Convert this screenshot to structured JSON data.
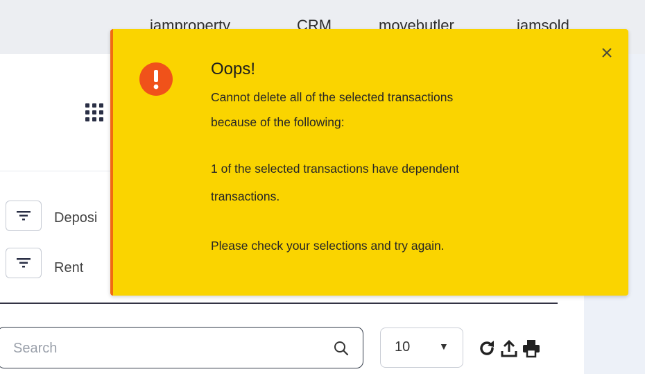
{
  "topnav": {
    "links": [
      "iamproperty",
      "CRM",
      "movebutler",
      "iamsold"
    ]
  },
  "filters": [
    {
      "label": "Deposi"
    },
    {
      "label": "Rent"
    }
  ],
  "search": {
    "placeholder": "Search",
    "value": ""
  },
  "pagination": {
    "page_size": "10"
  },
  "toolbar": {
    "icons": [
      "refresh-icon",
      "export-icon",
      "print-icon"
    ]
  },
  "alert": {
    "title": "Oops!",
    "lines": [
      "Cannot delete all of the selected transactions",
      "because of the following:",
      "1 of the selected transactions have dependent",
      "transactions.",
      "Please check your selections and try again."
    ],
    "icon": "exclamation-icon",
    "close_icon": "close-icon",
    "colors": {
      "background": "#fad400",
      "accent": "#f06a12",
      "icon_bg": "#f0521a"
    }
  }
}
